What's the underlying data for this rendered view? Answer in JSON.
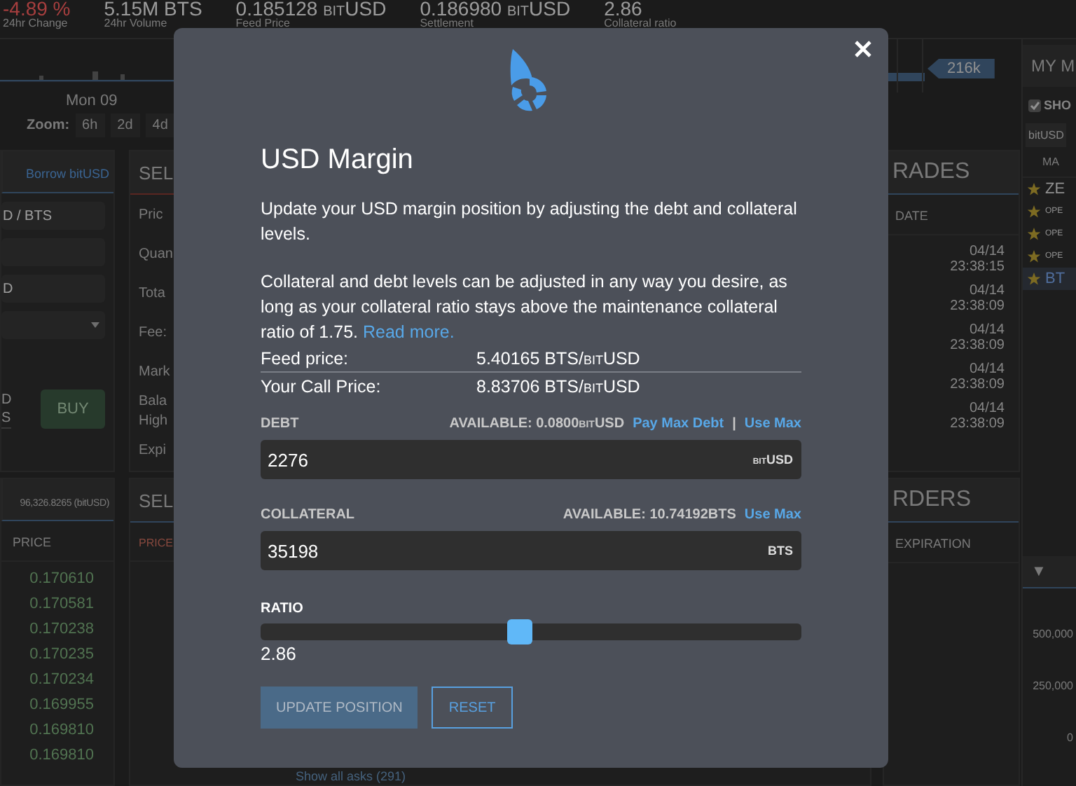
{
  "stats": [
    {
      "value": "-4.89 %",
      "label": "24hr Change",
      "kind": "down"
    },
    {
      "value": "5.15M BTS",
      "label": "24hr Volume",
      "kind": "plain"
    },
    {
      "value": "0.185128 bitUSD",
      "label": "Feed Price",
      "kind": "plain"
    },
    {
      "value": "0.186980 bitUSD",
      "label": "Settlement",
      "kind": "plain"
    },
    {
      "value": "2.86",
      "label": "Collateral ratio",
      "kind": "plain"
    }
  ],
  "chart": {
    "date_label": "Mon 09",
    "zoom_label": "Zoom:",
    "zoom_options": [
      "6h",
      "2d",
      "4d"
    ],
    "price_tag": "216k"
  },
  "buy_panel": {
    "tab": "Borrow bitUSD",
    "fields": [
      {
        "kind": "text",
        "value": "D / BTS"
      },
      {
        "kind": "text"
      },
      {
        "kind": "text",
        "value": "D"
      },
      {
        "kind": "select"
      }
    ],
    "labels": [
      "D",
      "S"
    ],
    "button": "BUY"
  },
  "sell_panel": {
    "title": "SEL",
    "labels": [
      "Pric",
      "Quan",
      "Tota",
      "Fee:",
      "Mark",
      "Bala",
      "High",
      "Expi"
    ]
  },
  "trades": {
    "title": "RADES",
    "column": "DATE",
    "rows": [
      {
        "date": "04/14",
        "time": "23:38:15"
      },
      {
        "date": "04/14",
        "time": "23:38:09"
      },
      {
        "date": "04/14",
        "time": "23:38:09"
      },
      {
        "date": "04/14",
        "time": "23:38:09"
      },
      {
        "date": "04/14",
        "time": "23:38:09"
      }
    ]
  },
  "bids": {
    "title": "96,326.8265 (bitUSD)",
    "column": "PRICE",
    "prices": [
      "0.170610",
      "0.170581",
      "0.170238",
      "0.170235",
      "0.170234",
      "0.169955",
      "0.169810",
      "0.169810"
    ]
  },
  "asks": {
    "title": "SEL",
    "column": "PRICE",
    "footer": "Show all asks (291)"
  },
  "orders": {
    "title": "RDERS",
    "column": "EXPIRATION"
  },
  "markets": {
    "title": "MY M",
    "checkbox": {
      "label": "SHO",
      "checked": true
    },
    "tab": "bitUSD",
    "column": "MA",
    "rows": [
      {
        "name": "ZE",
        "kind": "large",
        "selected": false
      },
      {
        "name": "OPE",
        "kind": "small",
        "selected": false
      },
      {
        "name": "OPE",
        "kind": "small",
        "selected": false
      },
      {
        "name": "OPE",
        "kind": "small",
        "selected": false
      },
      {
        "name": "BT",
        "kind": "large",
        "selected": true
      }
    ]
  },
  "depth": {
    "toggle": "▼",
    "axis_labels": [
      "500,000",
      "250,000",
      "0"
    ]
  },
  "modal": {
    "title": "USD Margin",
    "intro": "Update your USD margin position by adjusting the debt and collateral levels.",
    "note": "Collateral and debt levels can be adjusted in any way you desire, as long as your collateral ratio stays above the maintenance collateral ratio of 1.75.",
    "note_link": "Read more.",
    "info": [
      {
        "label": "Feed price:",
        "value": "5.40165 BTS/bitUSD"
      },
      {
        "label": "Your Call Price:",
        "value": "8.83706 BTS/bitUSD"
      }
    ],
    "link_separator": "|",
    "fields": [
      {
        "label": "DEBT",
        "available": "AVAILABLE: 0.0800bitUSD",
        "links": [
          "Pay Max Debt",
          "Use Max"
        ],
        "value": "2276",
        "unit": "bitUSD"
      },
      {
        "label": "COLLATERAL",
        "available": "AVAILABLE: 10.74192BTS",
        "links": [
          "Use Max"
        ],
        "value": "35198",
        "unit": "BTS"
      }
    ],
    "ratio": {
      "label": "RATIO",
      "level": 0.48,
      "reading": "2.86"
    },
    "buttons": [
      {
        "label": "UPDATE POSITION",
        "kind": "primary",
        "disabled": true
      },
      {
        "label": "RESET",
        "kind": "outline",
        "disabled": false
      }
    ]
  }
}
